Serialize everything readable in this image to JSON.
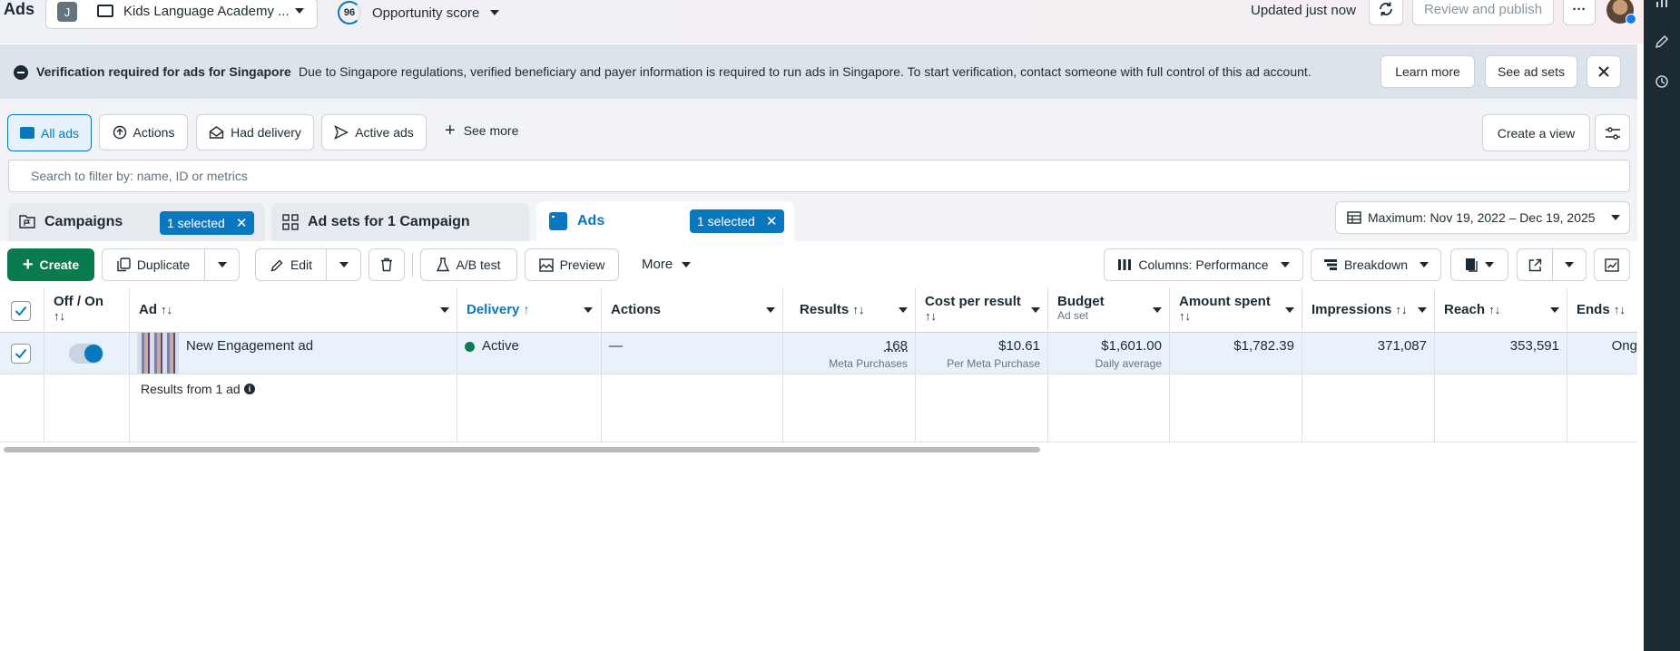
{
  "header": {
    "title": "Ads",
    "account_initial": "J",
    "account_name": "Kids Language Academy ...",
    "opportunity_score": "96",
    "opportunity_label": "Opportunity score",
    "updated": "Updated just now",
    "review_publish": "Review and publish",
    "more_menu": "···"
  },
  "banner": {
    "title": "Verification required for ads for Singapore",
    "message": "Due to Singapore regulations, verified beneficiary and payer information is required to run ads in Singapore. To start verification, contact someone with full control of this ad account.",
    "learn_more": "Learn more",
    "see_ad_sets": "See ad sets"
  },
  "views": {
    "all_ads": "All ads",
    "actions": "Actions",
    "had_delivery": "Had delivery",
    "active_ads": "Active ads",
    "see_more": "See more",
    "create_view": "Create a view"
  },
  "search": {
    "placeholder": "Search to filter by: name, ID or metrics"
  },
  "tabs": {
    "campaigns": "Campaigns",
    "campaigns_selected": "1 selected",
    "adsets": "Ad sets for 1 Campaign",
    "ads": "Ads",
    "ads_selected": "1 selected",
    "date_range": "Maximum: Nov 19, 2022 – Dec 19, 2025"
  },
  "toolbar": {
    "create": "Create",
    "duplicate": "Duplicate",
    "edit": "Edit",
    "ab_test": "A/B test",
    "preview": "Preview",
    "more": "More",
    "columns": "Columns: Performance",
    "breakdown": "Breakdown"
  },
  "table": {
    "headers": {
      "off_on": "Off / On",
      "ad": "Ad",
      "delivery": "Delivery",
      "actions": "Actions",
      "results": "Results",
      "cost_per_result": "Cost per result",
      "budget": "Budget",
      "budget_sub": "Ad set",
      "amount_spent": "Amount spent",
      "impressions": "Impressions",
      "reach": "Reach",
      "ends": "Ends"
    },
    "row": {
      "ad_name": "New Engagement ad",
      "delivery": "Active",
      "actions": "—",
      "results": "168",
      "results_sub": "Meta Purchases",
      "cost_per_result": "$10.61",
      "cost_sub": "Per Meta Purchase",
      "budget": "$1,601.00",
      "budget_sub": "Daily average",
      "amount_spent": "$1,782.39",
      "impressions": "371,087",
      "reach": "353,591",
      "ends": "Ong"
    },
    "footer": "Results from 1 ad"
  },
  "colors": {
    "accent": "#0a78be",
    "create_green": "#0a7a4f",
    "active_dot": "#0a7a4f"
  }
}
